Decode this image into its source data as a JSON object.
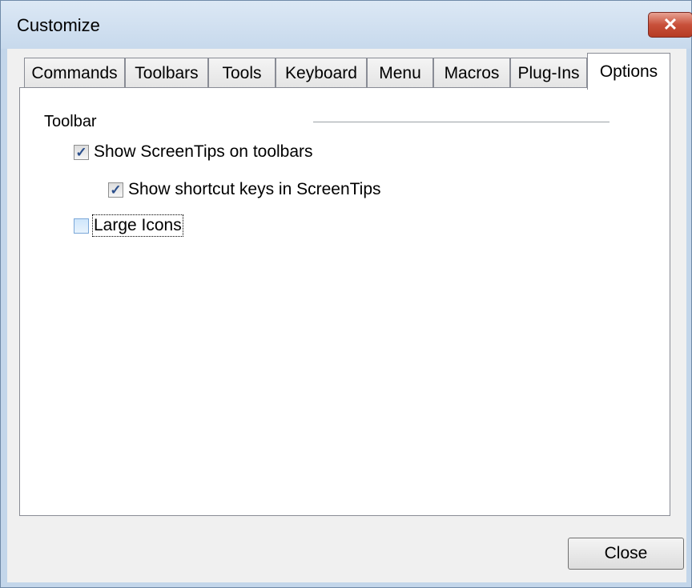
{
  "window": {
    "title": "Customize"
  },
  "tabs": [
    {
      "label": "Commands",
      "active": false
    },
    {
      "label": "Toolbars",
      "active": false
    },
    {
      "label": "Tools",
      "active": false
    },
    {
      "label": "Keyboard",
      "active": false
    },
    {
      "label": "Menu",
      "active": false
    },
    {
      "label": "Macros",
      "active": false
    },
    {
      "label": "Plug-Ins",
      "active": false
    },
    {
      "label": "Options",
      "active": true
    }
  ],
  "options": {
    "group_label": "Toolbar",
    "show_screentips": {
      "label": "Show ScreenTips on toolbars",
      "checked": true
    },
    "show_shortcut_keys": {
      "label": "Show shortcut keys in ScreenTips",
      "checked": true
    },
    "large_icons": {
      "label": "Large Icons",
      "checked": false
    }
  },
  "buttons": {
    "close": "Close"
  },
  "icons": {
    "close": "close-icon",
    "check": "checkmark-icon"
  }
}
